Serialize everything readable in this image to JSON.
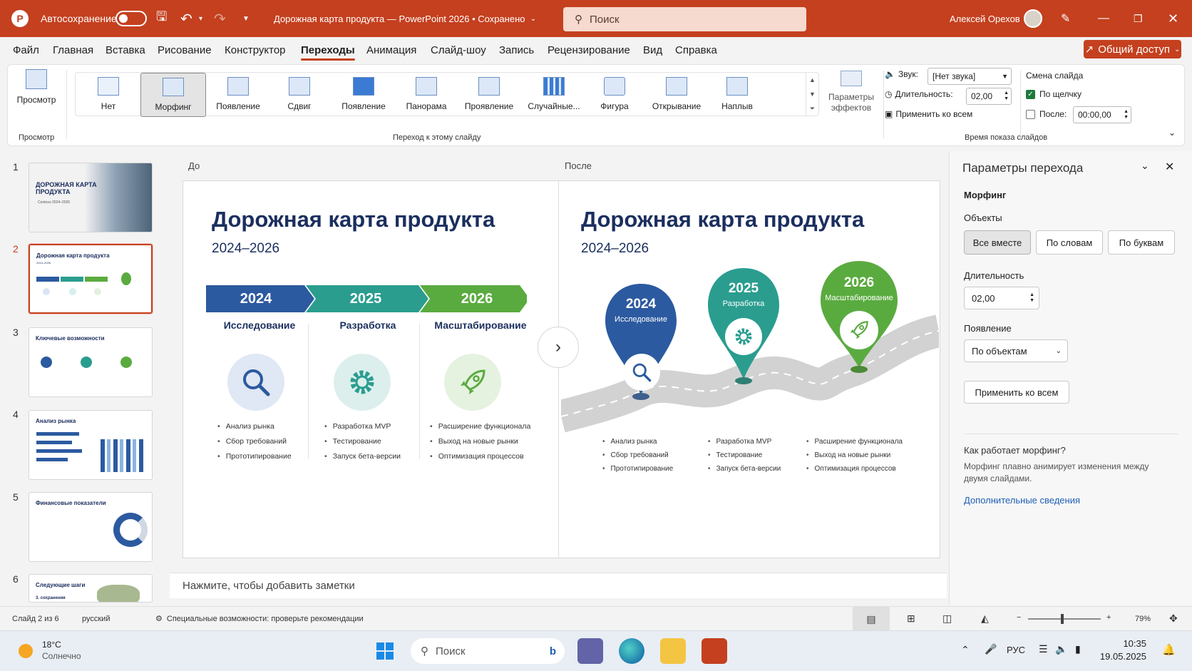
{
  "titlebar": {
    "autosave_label": "Автосохранение",
    "doc_title": "Дорожная карта продукта — PowerPoint 2026  •  Сохранено",
    "search_placeholder": "Поиск",
    "user": "Алексей Орехов"
  },
  "menu": {
    "items": [
      "Файл",
      "Главная",
      "Вставка",
      "Рисование",
      "Конструктор",
      "Переходы",
      "Анимация",
      "Слайд-шоу",
      "Запись",
      "Рецензирование",
      "Вид",
      "Справка"
    ],
    "active": "Переходы",
    "share": "Общий доступ"
  },
  "ribbon": {
    "preview_label": "Просмотр",
    "preview_group": "Просмотр",
    "transitions": [
      "Нет",
      "Морфинг",
      "Появление",
      "Сдвиг",
      "Появление",
      "Панорама",
      "Проявление",
      "Случайные...",
      "Фигура",
      "Открывание",
      "Наплыв"
    ],
    "selected_transition": "Морфинг",
    "effects_label": "Параметры эффектов",
    "transitions_group": "Переход к этому слайду",
    "sound_label": "Звук:",
    "sound_value": "[Нет звука]",
    "duration_label": "Длительность:",
    "duration_value": "02,00",
    "apply_all": "Применить ко всем",
    "advance_label": "Смена слайда",
    "on_click": "По щелчку",
    "after_label": "После:",
    "after_value": "00:00,00",
    "timing_group": "Время показа слайдов"
  },
  "thumbs": [
    {
      "n": "1",
      "title": "ДОРОЖНАЯ КАРТА ПРОДУКТА",
      "sub": "Contoso 2024–2026"
    },
    {
      "n": "2",
      "title": "Дорожная карта продукта",
      "sub": "2024–2026"
    },
    {
      "n": "3",
      "title": "Ключевые возможности",
      "sub": ""
    },
    {
      "n": "4",
      "title": "Анализ рынка",
      "sub": ""
    },
    {
      "n": "5",
      "title": "Финансовые показатели",
      "sub": ""
    },
    {
      "n": "6",
      "title": "Следующие шаги",
      "sub": "3. сохранения"
    }
  ],
  "compare": {
    "before": "До",
    "after": "После"
  },
  "slide": {
    "title": "Дорожная карта продукта",
    "subtitle": "2024–2026",
    "years": [
      "2024",
      "2025",
      "2026"
    ],
    "phases": [
      "Исследование",
      "Разработка",
      "Масштабирование"
    ],
    "bullets": [
      [
        "Анализ рынка",
        "Сбор требований",
        "Прототипирование"
      ],
      [
        "Разработка MVP",
        "Тестирование",
        "Запуск бета-версии"
      ],
      [
        "Расширение функционала",
        "Выход на новые рынки",
        "Оптимизация процессов"
      ]
    ],
    "colors": {
      "blue": "#2c5aa0",
      "teal": "#2a9d8f",
      "green": "#5aab3f"
    }
  },
  "notes_placeholder": "Нажмите, чтобы добавить заметки",
  "pane": {
    "title": "Параметры перехода",
    "effect": "Морфинг",
    "objects_label": "Объекты",
    "objects_options": [
      "Все вместе",
      "По словам",
      "По буквам"
    ],
    "duration_label": "Длительность",
    "duration_value": "02,00",
    "appearance_label": "Появление",
    "appearance_value": "По объектам",
    "apply_all": "Применить ко всем",
    "help_title": "Как работает морфинг?",
    "help_text": "Морфинг плавно анимирует изменения между двумя слайдами.",
    "help_link": "Дополнительные сведения"
  },
  "status": {
    "slide": "Слайд 2 из 6",
    "lang": "русский",
    "accessibility": "Специальные возможности: проверьте рекомендации",
    "zoom": "79%"
  },
  "taskbar": {
    "temp": "18°C",
    "weather": "Солнечно",
    "search": "Поиск",
    "lang": "РУС",
    "time": "10:35",
    "date": "19.05.2025"
  }
}
